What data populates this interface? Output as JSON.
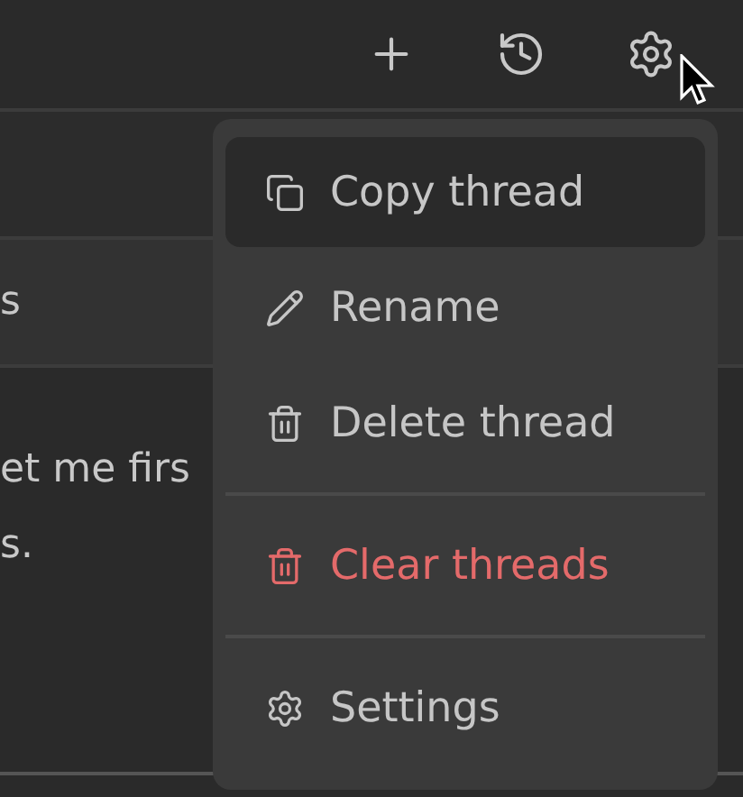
{
  "toolbar": {
    "buttons": [
      {
        "kind": "new"
      },
      {
        "kind": "history"
      },
      {
        "kind": "settings"
      }
    ]
  },
  "list": {
    "rows": [
      {
        "kind": "blank"
      },
      {
        "kind": "item",
        "text": "s"
      }
    ]
  },
  "message": {
    "lines": [
      "et me firs",
      "s."
    ]
  },
  "menu": {
    "groups": [
      {
        "items": [
          {
            "label": "Copy thread",
            "kind": "copy",
            "selected": true
          },
          {
            "label": "Rename",
            "kind": "rename",
            "selected": false
          },
          {
            "label": "Delete thread",
            "kind": "delete",
            "selected": false
          }
        ]
      },
      {
        "items": [
          {
            "label": "Clear threads",
            "kind": "clear",
            "selected": false
          }
        ]
      },
      {
        "items": [
          {
            "label": "Settings",
            "kind": "settings",
            "selected": false
          }
        ]
      }
    ]
  }
}
